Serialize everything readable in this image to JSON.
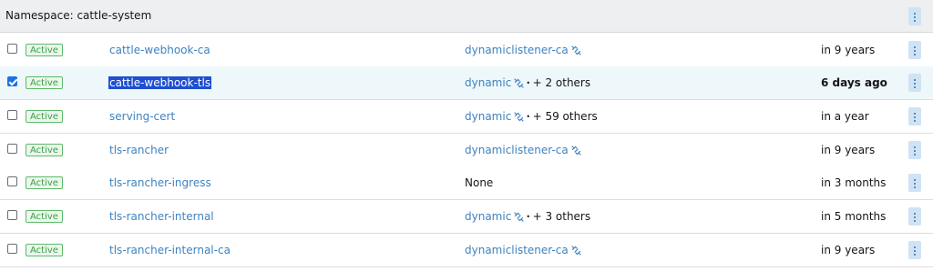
{
  "group": {
    "label": "Namespace: cattle-system"
  },
  "status_colors": {
    "active_text": "#39a048",
    "link": "#3d83c1"
  },
  "rows": [
    {
      "checked": false,
      "status": "Active",
      "name": "cattle-webhook-ca",
      "issuer_link": "dynamiclistener-ca",
      "issuer_icon": "unlink-icon",
      "issuer_extra": "",
      "expires": "in 9 years",
      "expires_bold": false,
      "name_highlight": false
    },
    {
      "checked": true,
      "status": "Active",
      "name": "cattle-webhook-tls",
      "issuer_link": "dynamic",
      "issuer_icon": "unlink-icon",
      "issuer_extra": "+ 2 others",
      "expires": "6 days ago",
      "expires_bold": true,
      "name_highlight": true
    },
    {
      "checked": false,
      "status": "Active",
      "name": "serving-cert",
      "issuer_link": "dynamic",
      "issuer_icon": "unlink-icon",
      "issuer_extra": "+ 59 others",
      "expires": "in a year",
      "expires_bold": false,
      "name_highlight": false
    },
    {
      "checked": false,
      "status": "Active",
      "name": "tls-rancher",
      "issuer_link": "dynamiclistener-ca",
      "issuer_icon": "unlink-icon",
      "issuer_extra": "",
      "expires": "in 9 years",
      "expires_bold": false,
      "name_highlight": false
    },
    {
      "checked": false,
      "status": "Active",
      "name": "tls-rancher-ingress",
      "issuer_none": "None",
      "issuer_extra": "",
      "expires": "in 3 months",
      "expires_bold": false,
      "name_highlight": false
    },
    {
      "checked": false,
      "status": "Active",
      "name": "tls-rancher-internal",
      "issuer_link": "dynamic",
      "issuer_icon": "unlink-icon",
      "issuer_extra": "+ 3 others",
      "expires": "in 5 months",
      "expires_bold": false,
      "name_highlight": false
    },
    {
      "checked": false,
      "status": "Active",
      "name": "tls-rancher-internal-ca",
      "issuer_link": "dynamiclistener-ca",
      "issuer_icon": "unlink-icon",
      "issuer_extra": "",
      "expires": "in 9 years",
      "expires_bold": false,
      "name_highlight": false
    }
  ]
}
